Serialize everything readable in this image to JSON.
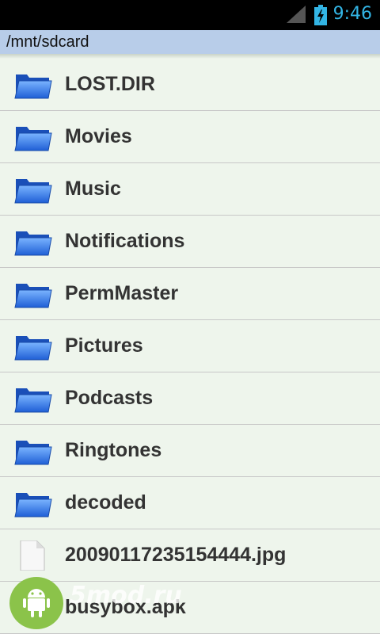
{
  "status_bar": {
    "time": "9:46"
  },
  "path": "/mnt/sdcard",
  "items": [
    {
      "label": "LOST.DIR",
      "icon": "folder-icon"
    },
    {
      "label": "Movies",
      "icon": "folder-icon"
    },
    {
      "label": "Music",
      "icon": "folder-icon"
    },
    {
      "label": "Notifications",
      "icon": "folder-icon"
    },
    {
      "label": "PermMaster",
      "icon": "folder-icon"
    },
    {
      "label": "Pictures",
      "icon": "folder-icon"
    },
    {
      "label": "Podcasts",
      "icon": "folder-icon"
    },
    {
      "label": "Ringtones",
      "icon": "folder-icon"
    },
    {
      "label": "decoded",
      "icon": "folder-icon"
    },
    {
      "label": "20090117235154444.jpg",
      "icon": "file-icon"
    },
    {
      "label": "busybox.apk",
      "icon": "file-icon"
    }
  ],
  "watermark": {
    "text": "5mod.ru",
    "icon": "android-icon"
  },
  "colors": {
    "accent": "#33b5e5",
    "path_bar": "#b8cde9",
    "list_bg": "#eef5ec",
    "folder": "#2f74e0"
  }
}
